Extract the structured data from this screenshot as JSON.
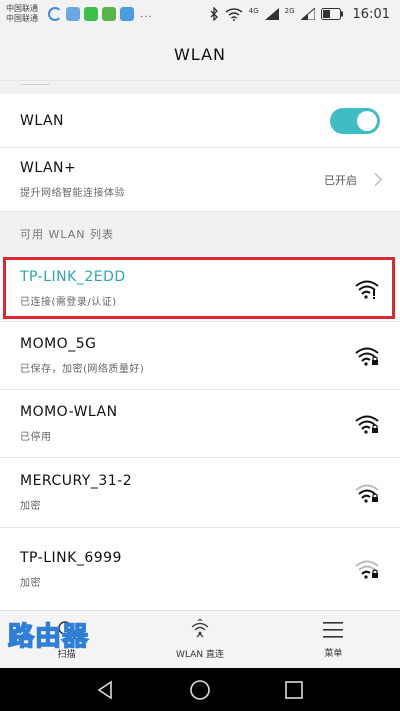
{
  "status_bar": {
    "carrier_1": "中国联通",
    "carrier_2": "中国联通",
    "overflow": "...",
    "network_1": "4G",
    "network_2": "2G",
    "time": "16:01"
  },
  "header": {
    "title": "WLAN"
  },
  "settings": {
    "wlan_label": "WLAN",
    "wlan_enabled": true,
    "wlan_plus_label": "WLAN+",
    "wlan_plus_sub": "提升网络智能连接体验",
    "wlan_plus_status": "已开启"
  },
  "section_header": "可用 WLAN 列表",
  "networks": [
    {
      "name": "TP-LINK_2EDD",
      "status": "已连接(需登录/认证)"
    },
    {
      "name": "MOMO_5G",
      "status": "已保存，加密(网络质量好)"
    },
    {
      "name": "MOMO-WLAN",
      "status": "已停用"
    },
    {
      "name": "MERCURY_31-2",
      "status": "加密"
    },
    {
      "name": "TP-LINK_6999",
      "status": "加密"
    }
  ],
  "tab_bar": {
    "scan": "扫描",
    "wlan_direct": "WLAN 直连",
    "menu": "菜单"
  },
  "watermark": "路由器",
  "colors": {
    "accent": "#3fbdc4",
    "highlight": "#e0262f"
  }
}
